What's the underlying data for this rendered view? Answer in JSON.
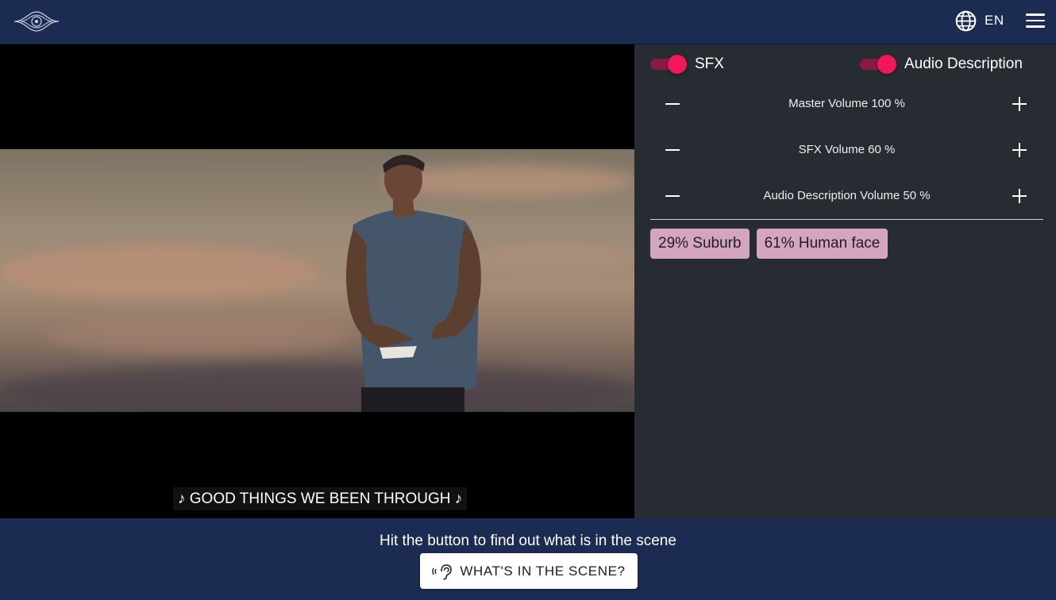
{
  "header": {
    "logo_icon": "eye-logo-icon",
    "globe_icon": "globe-icon",
    "language": "EN",
    "menu_icon": "hamburger-menu-icon"
  },
  "video": {
    "subtitle": "♪ GOOD THINGS WE BEEN THROUGH ♪"
  },
  "panel": {
    "toggles": [
      {
        "label": "SFX",
        "on": true
      },
      {
        "label": "Audio Description",
        "on": true
      }
    ],
    "volumes": [
      {
        "label": "Master Volume 100 %"
      },
      {
        "label": "SFX Volume 60 %"
      },
      {
        "label": "Audio Description Volume 50 %"
      }
    ],
    "tags": [
      {
        "label": "29%  Suburb"
      },
      {
        "label": "61%  Human face"
      }
    ]
  },
  "footer": {
    "hint": "Hit the button to find out what is in the scene",
    "button_label": "WHAT'S IN THE SCENE?",
    "button_icon": "ear-sound-icon"
  },
  "colors": {
    "header_bg": "#1c2b52",
    "panel_bg": "#262c31",
    "toggle_accent": "#f0185a",
    "tag_bg": "#d5a5c0"
  }
}
